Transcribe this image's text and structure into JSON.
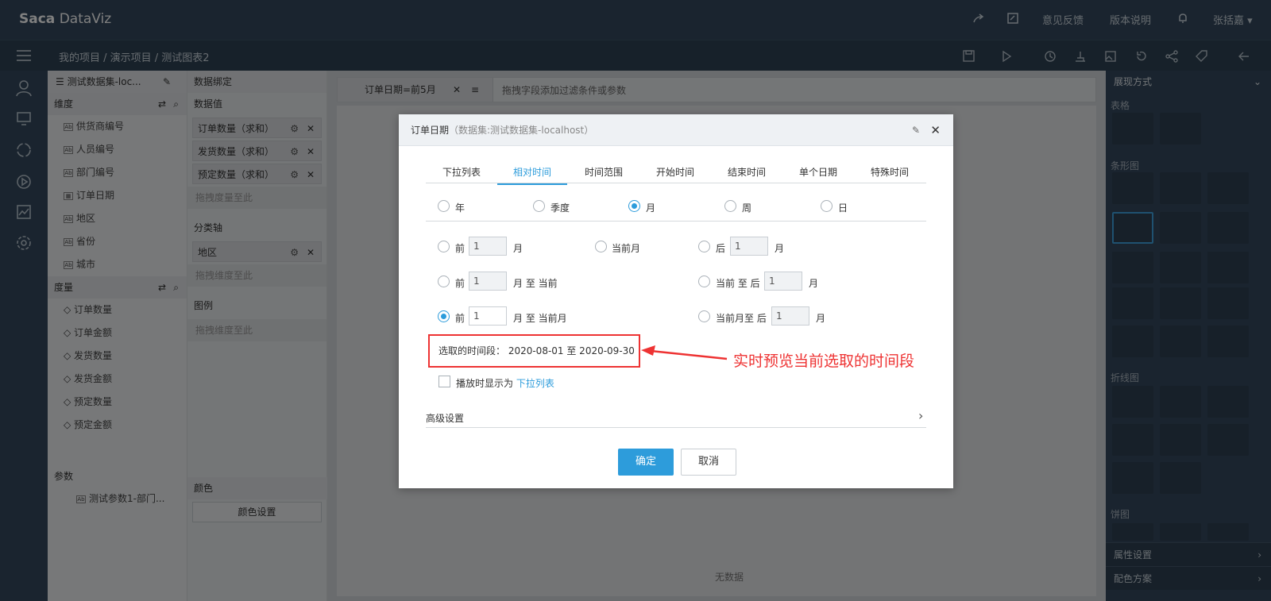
{
  "app": {
    "logo_sa": "Sa",
    "logo_ca": "ca",
    "logo_name": "DataViz",
    "feedback": "意见反馈",
    "release": "版本说明",
    "user": "张括嘉 ▾"
  },
  "breadcrumb": "我的项目  /  演示项目  /  测试图表2",
  "dataset": {
    "title": "测试数据集-loc...",
    "dim_label": "维度",
    "dims": [
      "供货商编号",
      "人员编号",
      "部门编号",
      "订单日期",
      "地区",
      "省份",
      "城市"
    ],
    "measure_label": "度量",
    "measures": [
      "订单数量",
      "订单金额",
      "发货数量",
      "发货金额",
      "预定数量",
      "预定金额"
    ],
    "param_label": "参数",
    "params": [
      "测试参数1-部门..."
    ]
  },
  "binding": {
    "title": "数据绑定",
    "values_label": "数据值",
    "values": [
      "订单数量（求和）",
      "发货数量（求和）",
      "预定数量（求和）"
    ],
    "values_drop": "拖拽度量至此",
    "axis_label": "分类轴",
    "axis": [
      "地区"
    ],
    "axis_drop": "拖拽维度至此",
    "legend_label": "图例",
    "legend_drop": "拖拽维度至此",
    "color_label": "颜色",
    "color_btn": "颜色设置"
  },
  "filter": {
    "tag": "订单日期=前5月",
    "hint": "拖拽字段添加过滤条件或参数"
  },
  "canvas": {
    "nodata": "无数据"
  },
  "right": {
    "title": "展现方式",
    "cats": [
      "表格",
      "条形图",
      "折线图",
      "饼图"
    ],
    "attr": "属性设置",
    "palette": "配色方案"
  },
  "dialog": {
    "title": "订单日期",
    "subtitle": "（数据集:测试数据集-localhost）",
    "tabs": [
      "下拉列表",
      "相对时间",
      "时间范围",
      "开始时间",
      "结束时间",
      "单个日期",
      "特殊时间"
    ],
    "units": [
      "年",
      "季度",
      "月",
      "周",
      "日"
    ],
    "r1a": "前",
    "r1b": "月",
    "r1c": "当前月",
    "r1d": "后",
    "r1e": "月",
    "r2a": "前",
    "r2b": "月 至 当前",
    "r2c": "当前 至 后",
    "r2d": "月",
    "r3a": "前",
    "r3b": "月 至 当前月",
    "r3c": "当前月至 后",
    "r3d": "月",
    "val": "1",
    "preview": "选取的时间段： 2020-08-01 至 2020-09-30",
    "play_label": "播放时显示为",
    "play_link": "下拉列表",
    "advanced": "高级设置",
    "ok": "确定",
    "cancel": "取消"
  },
  "annotation": "实时预览当前选取的时间段"
}
